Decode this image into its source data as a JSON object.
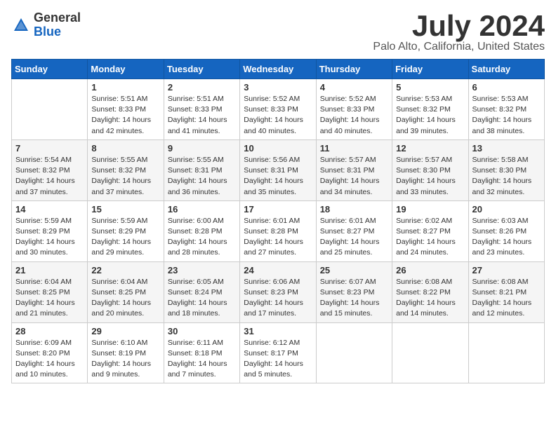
{
  "logo": {
    "general": "General",
    "blue": "Blue"
  },
  "title": "July 2024",
  "location": "Palo Alto, California, United States",
  "weekdays": [
    "Sunday",
    "Monday",
    "Tuesday",
    "Wednesday",
    "Thursday",
    "Friday",
    "Saturday"
  ],
  "weeks": [
    [
      {
        "day": "",
        "info": ""
      },
      {
        "day": "1",
        "info": "Sunrise: 5:51 AM\nSunset: 8:33 PM\nDaylight: 14 hours\nand 42 minutes."
      },
      {
        "day": "2",
        "info": "Sunrise: 5:51 AM\nSunset: 8:33 PM\nDaylight: 14 hours\nand 41 minutes."
      },
      {
        "day": "3",
        "info": "Sunrise: 5:52 AM\nSunset: 8:33 PM\nDaylight: 14 hours\nand 40 minutes."
      },
      {
        "day": "4",
        "info": "Sunrise: 5:52 AM\nSunset: 8:33 PM\nDaylight: 14 hours\nand 40 minutes."
      },
      {
        "day": "5",
        "info": "Sunrise: 5:53 AM\nSunset: 8:32 PM\nDaylight: 14 hours\nand 39 minutes."
      },
      {
        "day": "6",
        "info": "Sunrise: 5:53 AM\nSunset: 8:32 PM\nDaylight: 14 hours\nand 38 minutes."
      }
    ],
    [
      {
        "day": "7",
        "info": "Sunrise: 5:54 AM\nSunset: 8:32 PM\nDaylight: 14 hours\nand 37 minutes."
      },
      {
        "day": "8",
        "info": "Sunrise: 5:55 AM\nSunset: 8:32 PM\nDaylight: 14 hours\nand 37 minutes."
      },
      {
        "day": "9",
        "info": "Sunrise: 5:55 AM\nSunset: 8:31 PM\nDaylight: 14 hours\nand 36 minutes."
      },
      {
        "day": "10",
        "info": "Sunrise: 5:56 AM\nSunset: 8:31 PM\nDaylight: 14 hours\nand 35 minutes."
      },
      {
        "day": "11",
        "info": "Sunrise: 5:57 AM\nSunset: 8:31 PM\nDaylight: 14 hours\nand 34 minutes."
      },
      {
        "day": "12",
        "info": "Sunrise: 5:57 AM\nSunset: 8:30 PM\nDaylight: 14 hours\nand 33 minutes."
      },
      {
        "day": "13",
        "info": "Sunrise: 5:58 AM\nSunset: 8:30 PM\nDaylight: 14 hours\nand 32 minutes."
      }
    ],
    [
      {
        "day": "14",
        "info": "Sunrise: 5:59 AM\nSunset: 8:29 PM\nDaylight: 14 hours\nand 30 minutes."
      },
      {
        "day": "15",
        "info": "Sunrise: 5:59 AM\nSunset: 8:29 PM\nDaylight: 14 hours\nand 29 minutes."
      },
      {
        "day": "16",
        "info": "Sunrise: 6:00 AM\nSunset: 8:28 PM\nDaylight: 14 hours\nand 28 minutes."
      },
      {
        "day": "17",
        "info": "Sunrise: 6:01 AM\nSunset: 8:28 PM\nDaylight: 14 hours\nand 27 minutes."
      },
      {
        "day": "18",
        "info": "Sunrise: 6:01 AM\nSunset: 8:27 PM\nDaylight: 14 hours\nand 25 minutes."
      },
      {
        "day": "19",
        "info": "Sunrise: 6:02 AM\nSunset: 8:27 PM\nDaylight: 14 hours\nand 24 minutes."
      },
      {
        "day": "20",
        "info": "Sunrise: 6:03 AM\nSunset: 8:26 PM\nDaylight: 14 hours\nand 23 minutes."
      }
    ],
    [
      {
        "day": "21",
        "info": "Sunrise: 6:04 AM\nSunset: 8:25 PM\nDaylight: 14 hours\nand 21 minutes."
      },
      {
        "day": "22",
        "info": "Sunrise: 6:04 AM\nSunset: 8:25 PM\nDaylight: 14 hours\nand 20 minutes."
      },
      {
        "day": "23",
        "info": "Sunrise: 6:05 AM\nSunset: 8:24 PM\nDaylight: 14 hours\nand 18 minutes."
      },
      {
        "day": "24",
        "info": "Sunrise: 6:06 AM\nSunset: 8:23 PM\nDaylight: 14 hours\nand 17 minutes."
      },
      {
        "day": "25",
        "info": "Sunrise: 6:07 AM\nSunset: 8:23 PM\nDaylight: 14 hours\nand 15 minutes."
      },
      {
        "day": "26",
        "info": "Sunrise: 6:08 AM\nSunset: 8:22 PM\nDaylight: 14 hours\nand 14 minutes."
      },
      {
        "day": "27",
        "info": "Sunrise: 6:08 AM\nSunset: 8:21 PM\nDaylight: 14 hours\nand 12 minutes."
      }
    ],
    [
      {
        "day": "28",
        "info": "Sunrise: 6:09 AM\nSunset: 8:20 PM\nDaylight: 14 hours\nand 10 minutes."
      },
      {
        "day": "29",
        "info": "Sunrise: 6:10 AM\nSunset: 8:19 PM\nDaylight: 14 hours\nand 9 minutes."
      },
      {
        "day": "30",
        "info": "Sunrise: 6:11 AM\nSunset: 8:18 PM\nDaylight: 14 hours\nand 7 minutes."
      },
      {
        "day": "31",
        "info": "Sunrise: 6:12 AM\nSunset: 8:17 PM\nDaylight: 14 hours\nand 5 minutes."
      },
      {
        "day": "",
        "info": ""
      },
      {
        "day": "",
        "info": ""
      },
      {
        "day": "",
        "info": ""
      }
    ]
  ]
}
